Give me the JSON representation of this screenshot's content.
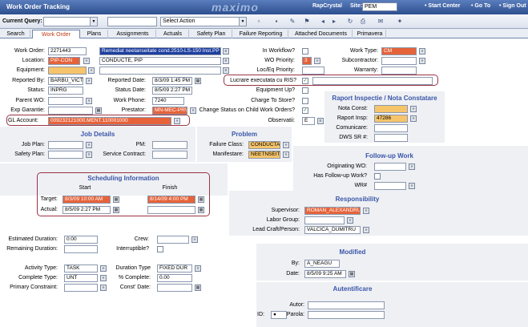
{
  "app": {
    "title": "Work Order Tracking",
    "logo": "maximo",
    "user": "RapCrystal",
    "site_label": "Site:",
    "site_value": "PEM",
    "start_center": "Start Center",
    "go_to": "Go To",
    "sign_out": "Sign Out"
  },
  "query": {
    "label": "Current Query:",
    "action": "Select Action"
  },
  "tabs": [
    "Search",
    "Work Order",
    "Plans",
    "Assignments",
    "Actuals",
    "Safety Plan",
    "Failure Reporting",
    "Attached Documents",
    "Primavera"
  ],
  "wo": {
    "work_order_label": "Work Order:",
    "work_order": "2271443",
    "description": "Remediat neetanseitate cond.2510-LS-150 Inst.PP",
    "location_label": "Location:",
    "location": "PIP-CON",
    "location_desc": "CONDUCTE, PIP",
    "equipment_label": "Equipment:",
    "reported_by_label": "Reported By:",
    "reported_by": "BARBU_VICTO",
    "reported_date_label": "Reported Date:",
    "reported_date": "8/3/09 1:45 PM",
    "status_label": "Status:",
    "status": "INPRG",
    "status_date_label": "Status Date:",
    "status_date": "8/5/09 2:27 PM",
    "parent_wo_label": "Parent WO:",
    "work_phone_label": "Work Phone:",
    "work_phone": "7240",
    "exp_garantie_label": "Exp Garantie:",
    "prestator_label": "Prestator:",
    "prestator": "MN-MEC-PRV",
    "gl_account_label": "GL Account:",
    "gl_account": "009232121000.MENT.110001000",
    "in_workflow_label": "In Workflow?",
    "wo_priority_label": "WO Priority:",
    "wo_priority": "3",
    "loc_eq_priority_label": "Loc/Eq Priority:",
    "lucrare_label": "Lucrare executata cu RIS?",
    "equipment_up_label": "Equipment Up?",
    "charge_label": "Charge To Store?",
    "change_status_label": "Change Status on Child Work Orders?",
    "observatii_label": "Observatii:",
    "observatii": "E",
    "work_type_label": "Work Type:",
    "work_type": "CM",
    "subcontractor_label": "Subcontractor:",
    "warranty_label": "Warranty:"
  },
  "raport": {
    "title": "Raport Inspectie / Nota Constatare",
    "nota_label": "Nota Const:",
    "raport_label": "Raport Insp:",
    "raport": "47286",
    "comunicare_label": "Comunicare:",
    "dws_label": "DWS SR #:"
  },
  "job": {
    "title": "Job Details",
    "job_plan_label": "Job Plan:",
    "safety_plan_label": "Safety Plan:",
    "pm_label": "PM:",
    "service_contract_label": "Service Contract:"
  },
  "problem": {
    "title": "Problem",
    "failure_class_label": "Failure Class:",
    "failure_class": "CONDUCTA",
    "manifestare_label": "Manifestare:",
    "manifestare": "NEETNSEITATE"
  },
  "followup": {
    "title": "Follow-up Work",
    "originating_label": "Originating WO:",
    "has_followup_label": "Has Follow-up Work?",
    "wr_label": "WR#"
  },
  "sched": {
    "title": "Scheduling Information",
    "start": "Start",
    "finish": "Finish",
    "target_label": "Target:",
    "target_start": "8/3/09 10:00 AM",
    "target_finish": "8/14/09 4:00 PM",
    "actual_label": "Actual:",
    "actual_start": "8/5/09 2:27 PM"
  },
  "resp": {
    "title": "Responsibility",
    "supervisor_label": "Supervisor:",
    "supervisor": "ROMAN_ALEXANDRU",
    "labor_group_label": "Labor Group:",
    "lead_craft_label": "Lead Craft/Person:",
    "lead_craft": "VALCICA_DUMITRU"
  },
  "dur": {
    "est_label": "Estimated Duration:",
    "est": "0:00",
    "rem_label": "Remaining Duration:",
    "crew_label": "Crew:",
    "interruptible_label": "Interruptible?",
    "activity_label": "Activity Type:",
    "activity": "TASK",
    "duration_type_label": "Duration Type",
    "duration_type": "FIXED DUR",
    "complete_type_label": "Complete Type:",
    "complete_type": "UNT",
    "pct_label": "% Complete:",
    "pct": "0.00",
    "primary_label": "Primary Constraint:",
    "const_date_label": "Const' Date:"
  },
  "modified": {
    "title": "Modified",
    "by_label": "By:",
    "by": "A_NEAGU",
    "date_label": "Date:",
    "date": "8/5/09 9:25 AM"
  },
  "auth": {
    "title": "Autentificare",
    "autor_label": "Autor:",
    "parola_label": "Parola:",
    "id_label": "ID:",
    "id": "●"
  }
}
